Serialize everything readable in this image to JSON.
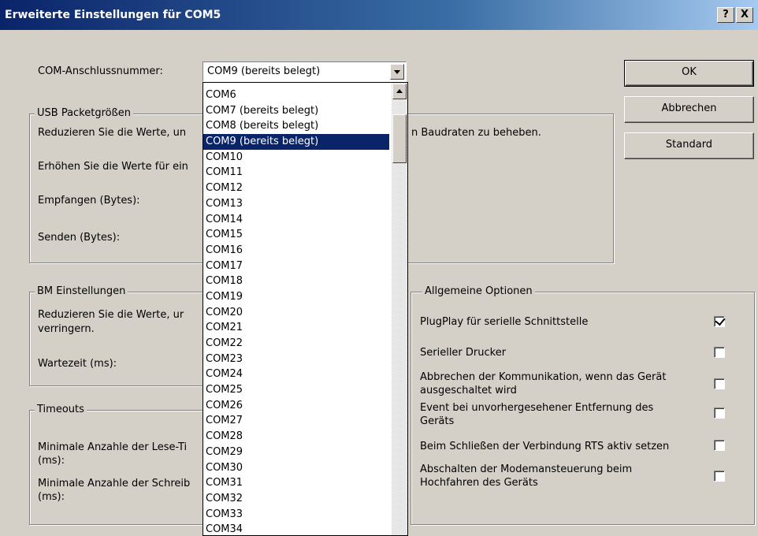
{
  "window": {
    "title": "Erweiterte Einstellungen für COM5",
    "help_label": "?",
    "close_label": "X"
  },
  "com_port": {
    "label": "COM-Anschlussnummer:",
    "selected": "COM9 (bereits belegt)",
    "options": [
      "COM6",
      "COM7 (bereits belegt)",
      "COM8 (bereits belegt)",
      "COM9 (bereits belegt)",
      "COM10",
      "COM11",
      "COM12",
      "COM13",
      "COM14",
      "COM15",
      "COM16",
      "COM17",
      "COM18",
      "COM19",
      "COM20",
      "COM21",
      "COM22",
      "COM23",
      "COM24",
      "COM25",
      "COM26",
      "COM27",
      "COM28",
      "COM29",
      "COM30",
      "COM31",
      "COM32",
      "COM33",
      "COM34"
    ],
    "selected_index": 3
  },
  "buttons": {
    "ok": "OK",
    "cancel": "Abbrechen",
    "default": "Standard"
  },
  "usb": {
    "legend": "USB Packetgrößen",
    "desc1_left": "Reduzieren Sie die Werte, un",
    "desc1_right": "n Baudraten zu beheben.",
    "desc2": "Erhöhen Sie die Werte für ein",
    "receive_label": "Empfangen (Bytes):",
    "send_label": "Senden (Bytes):"
  },
  "bm": {
    "legend": "BM Einstellungen",
    "desc_line1": "Reduzieren Sie die Werte, ur",
    "desc_line2": "verringern.",
    "latency_label": "Wartezeit (ms):"
  },
  "timeouts": {
    "legend": "Timeouts",
    "read_label_1": "Minimale Anzahle der Lese-Ti",
    "read_label_2": "(ms):",
    "write_label_1": "Minimale Anzahle der Schreib",
    "write_label_2": "(ms):"
  },
  "general": {
    "legend": "Allgemeine Optionen",
    "options": [
      {
        "label_1": "PlugPlay für serielle Schnittstelle",
        "label_2": "",
        "checked": true
      },
      {
        "label_1": "Serieller Drucker",
        "label_2": "",
        "checked": false
      },
      {
        "label_1": "Abbrechen der Kommunikation, wenn das Gerät",
        "label_2": "ausgeschaltet wird",
        "checked": false
      },
      {
        "label_1": "Event bei unvorhergesehener Entfernung des",
        "label_2": "Geräts",
        "checked": false
      },
      {
        "label_1": "Beim Schließen der Verbindung RTS aktiv setzen",
        "label_2": "",
        "checked": false
      },
      {
        "label_1": "Abschalten der Modemansteuerung beim",
        "label_2": "Hochfahren des Geräts",
        "checked": false
      }
    ]
  }
}
